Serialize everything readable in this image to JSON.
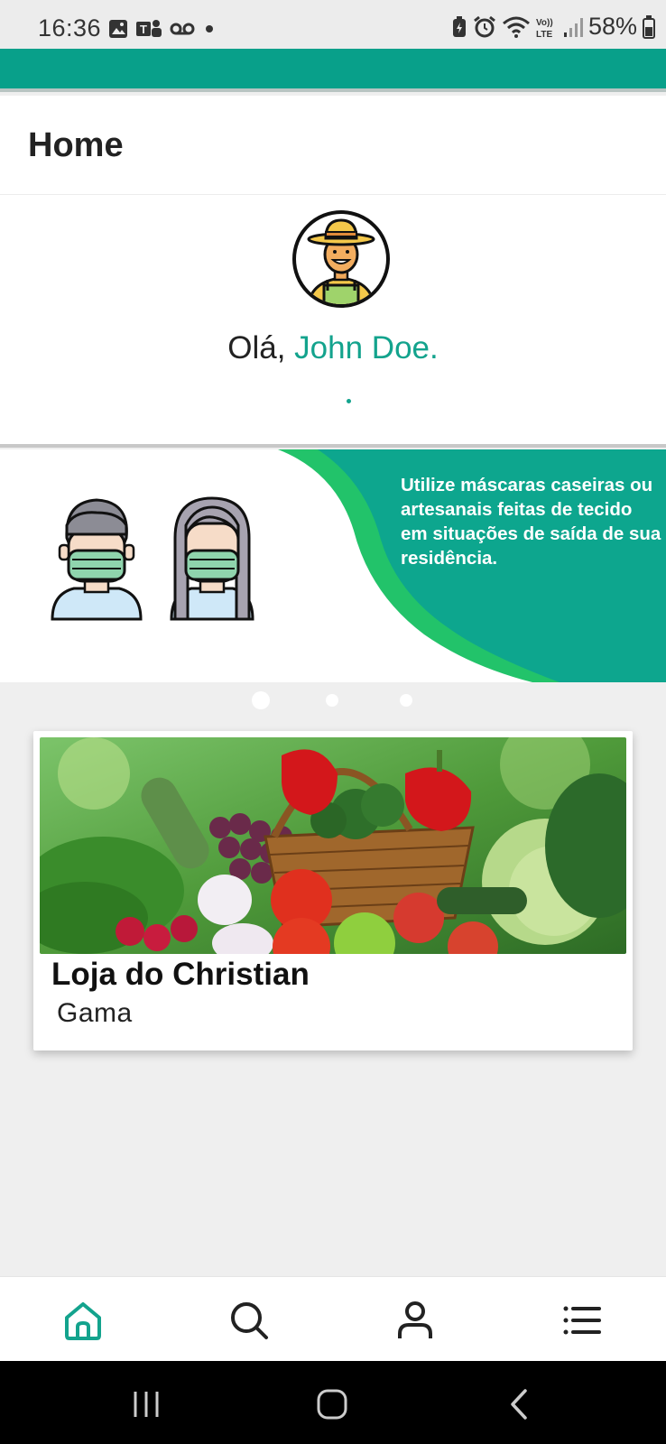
{
  "status_bar": {
    "time": "16:36",
    "battery": "58%",
    "left_icons": [
      "image-icon",
      "teams-icon",
      "voicemail-icon",
      "dot-icon"
    ],
    "right_icons": [
      "battery-saver-icon",
      "alarm-icon",
      "wifi-icon",
      "volte-icon",
      "signal-icon",
      "battery-icon"
    ]
  },
  "colors": {
    "accent": "#08a08a",
    "accent_text": "#13a38d",
    "banner_green": "#22c36a"
  },
  "header": {
    "title": "Home"
  },
  "greeting": {
    "prefix": "Olá, ",
    "name": "John Doe."
  },
  "banner": {
    "text": "Utilize máscaras caseiras ou  artesanais feitas de tecido em situações de saída de sua residência.",
    "active_slide": 0,
    "slide_count": 3
  },
  "store": {
    "name": "Loja do Christian",
    "location": "Gama"
  },
  "bottom_nav": {
    "items": [
      {
        "name": "home",
        "icon": "home-icon",
        "active": true
      },
      {
        "name": "search",
        "icon": "search-icon",
        "active": false
      },
      {
        "name": "profile",
        "icon": "user-icon",
        "active": false
      },
      {
        "name": "menu",
        "icon": "list-icon",
        "active": false
      }
    ]
  }
}
